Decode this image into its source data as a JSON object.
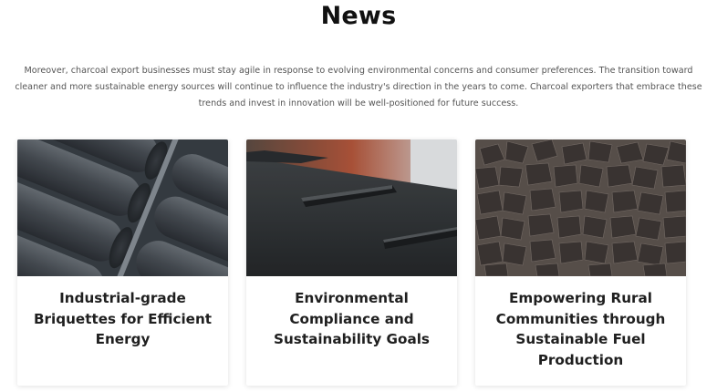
{
  "section": {
    "title": "News",
    "intro": "Moreover, charcoal export businesses must stay agile in response to evolving environmental concerns and consumer preferences. The transition toward cleaner and more sustainable energy sources will continue to influence the industry's direction in the years to come. Charcoal exporters that embrace these trends and invest in innovation will be well-positioned for future success."
  },
  "cards": [
    {
      "title": "Industrial-grade Briquettes for Efficient Energy",
      "image": "cylindrical-briquettes-photo"
    },
    {
      "title": "Environmental Compliance and Sustainability Goals",
      "image": "conveyor-belt-photo"
    },
    {
      "title": "Empowering Rural Communities through Sustainable Fuel Production",
      "image": "charcoal-cubes-pile-photo"
    }
  ]
}
